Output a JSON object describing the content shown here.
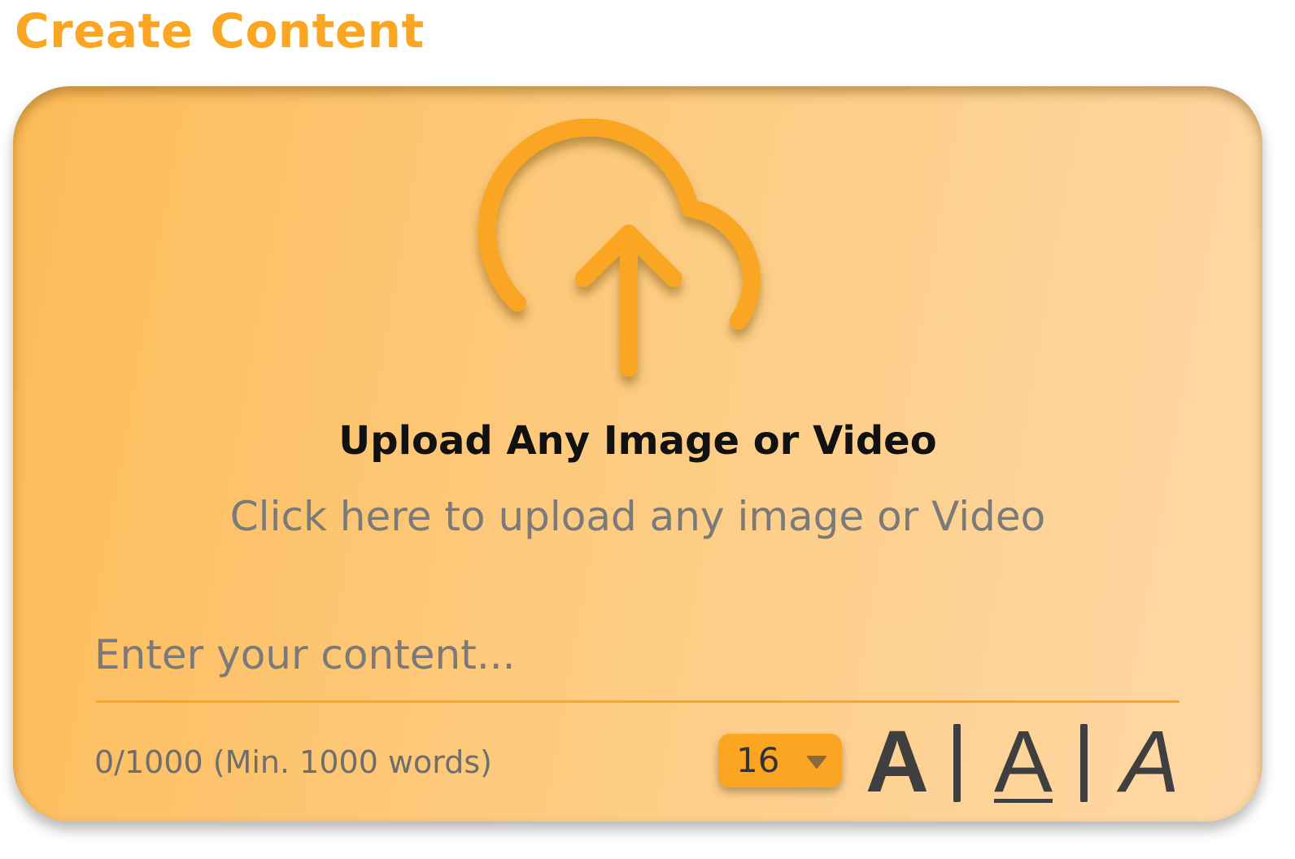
{
  "page": {
    "title": "Create Content"
  },
  "upload": {
    "icon": "cloud-upload-icon",
    "title": "Upload Any Image or Video",
    "subtitle": "Click here to upload any image or Video"
  },
  "editor": {
    "placeholder": "Enter your content...",
    "value": "",
    "counter": "0/1000 (Min. 1000 words)"
  },
  "toolbar": {
    "font_size": "16",
    "bold_label": "A",
    "underline_label": "A",
    "italic_label": "A"
  },
  "colors": {
    "accent": "#fba623",
    "card_gradient_start": "#fdbb58",
    "card_gradient_end": "#fed8a6",
    "toolbar_text": "#3f3f3f"
  }
}
